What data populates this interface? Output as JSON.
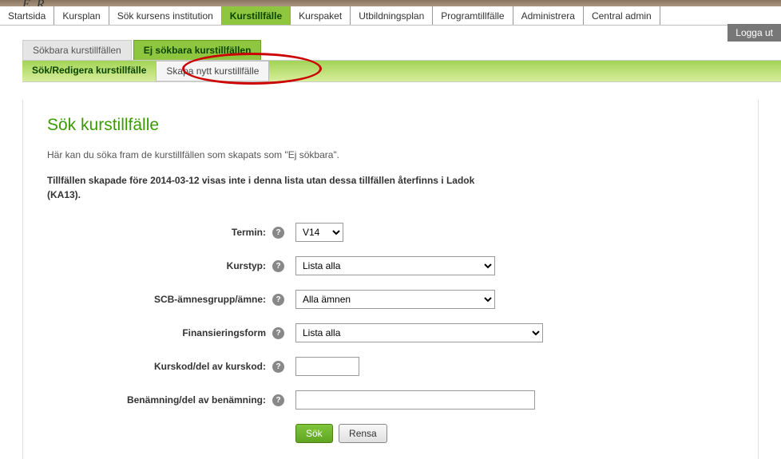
{
  "logo_fragment": "E R",
  "topnav": {
    "items": [
      "Startsida",
      "Kursplan",
      "Sök kursens institution",
      "Kurstillfälle",
      "Kurspaket",
      "Utbildningsplan",
      "Programtillfälle",
      "Administrera",
      "Central admin"
    ],
    "active_index": 3,
    "logout": "Logga ut"
  },
  "subtabs1": {
    "items": [
      "Sökbara kurstillfällen",
      "Ej sökbara kurstillfällen"
    ],
    "active_index": 1
  },
  "subtabs2": {
    "items": [
      "Sök/Redigera kurstillfälle",
      "Skapa nytt kurstillfälle"
    ],
    "active_index": 0
  },
  "page": {
    "title": "Sök kurstillfälle",
    "intro": "Här kan du söka fram de kurstillfällen som skapats som \"Ej sökbara\".",
    "note": "Tillfällen skapade före 2014-03-12 visas inte i denna lista utan dessa tillfällen återfinns i Ladok (KA13)."
  },
  "form": {
    "termin": {
      "label": "Termin:",
      "value": "V14"
    },
    "kurstyp": {
      "label": "Kurstyp:",
      "value": "Lista alla"
    },
    "scb": {
      "label": "SCB-ämnesgrupp/ämne:",
      "value": "Alla ämnen"
    },
    "finans": {
      "label": "Finansieringsform",
      "value": "Lista alla"
    },
    "kurskod": {
      "label": "Kurskod/del av kurskod:",
      "value": ""
    },
    "benamn": {
      "label": "Benämning/del av benämning:",
      "value": ""
    },
    "search_btn": "Sök",
    "reset_btn": "Rensa"
  }
}
